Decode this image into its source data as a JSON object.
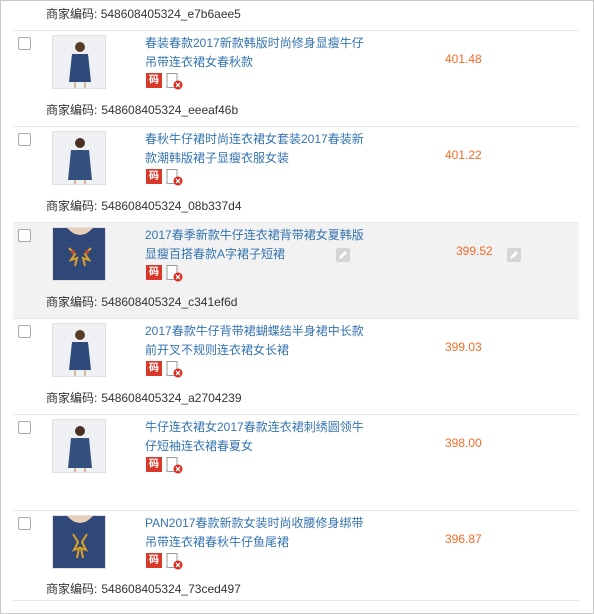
{
  "merchant_code_label": "商家编码:",
  "top_code": {
    "label": "商家编码:",
    "value": "548608405324_e7b6aee5"
  },
  "code_badge_text": "码",
  "colors": {
    "link": "#3474b0",
    "price": "#f26a2a",
    "badge_red": "#d9392b",
    "hover_row": "#f2f2f2"
  },
  "products": [
    {
      "title": "春装春款2017新款韩版时尚修身显瘦牛仔吊带连衣裙女春秋款",
      "price": "401.48",
      "code": "548608405324_eeeaf46b"
    },
    {
      "title": "春秋牛仔裙时尚连衣裙女套装2017春装新款潮韩版裙子显瘦衣服女装",
      "price": "401.22",
      "code": "548608405324_08b337d4"
    },
    {
      "title": "2017春季新款牛仔连衣裙背带裙女夏韩版显瘦百搭春款A字裙子短裙",
      "price": "399.52",
      "code": "548608405324_c341ef6d"
    },
    {
      "title": "2017春款牛仔背带裙蝴蝶结半身裙中长款前开叉不规则连衣裙女长裙",
      "price": "399.03",
      "code": "548608405324_a2704239"
    },
    {
      "title": "牛仔连衣裙女2017春款连衣裙刺绣圆领牛仔短袖连衣裙春夏女",
      "price": "398.00",
      "code": ""
    },
    {
      "title": "PAN2017春款新款女装时尚收腰修身绑带吊带连衣裙春秋牛仔鱼尾裙",
      "price": "396.87",
      "code": "548608405324_73ced497"
    }
  ]
}
